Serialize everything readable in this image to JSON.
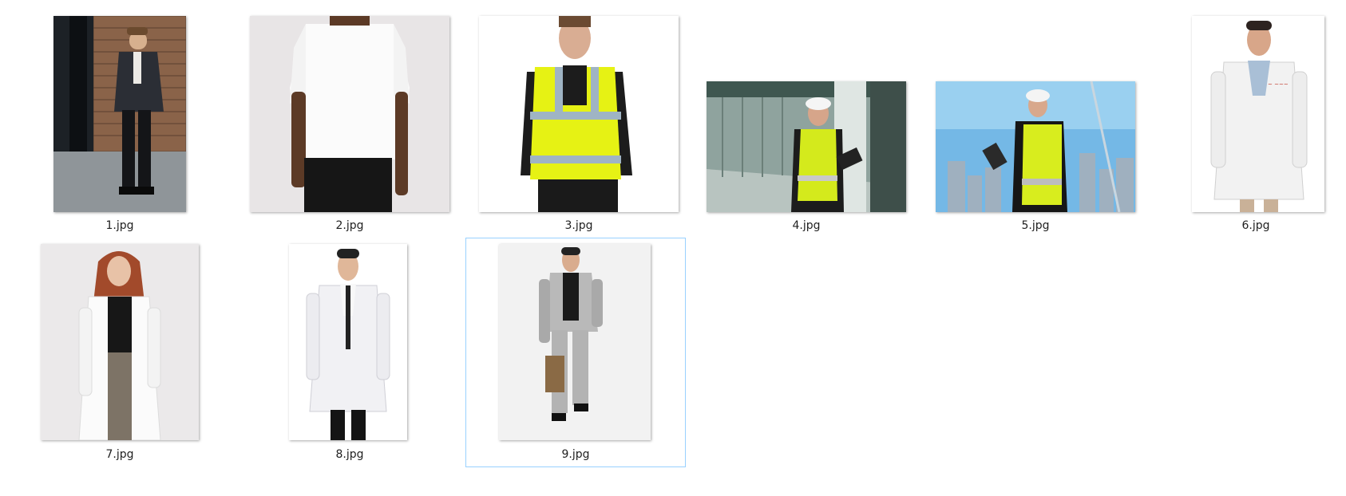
{
  "view": "large-icons",
  "selected_file": "9.jpg",
  "colors": {
    "selection_border": "#99d1ff",
    "label_text": "#1f1f1f"
  },
  "files": [
    {
      "name": "1.jpg",
      "depicts": "man in dark suit and sunglasses by brick wall"
    },
    {
      "name": "2.jpg",
      "depicts": "man in white t-shirt"
    },
    {
      "name": "3.jpg",
      "depicts": "man in yellow high-visibility vest"
    },
    {
      "name": "4.jpg",
      "depicts": "worker in hard hat and safety vest holding tablet in office"
    },
    {
      "name": "5.jpg",
      "depicts": "worker in hard hat and safety vest outdoors against sky"
    },
    {
      "name": "6.jpg",
      "depicts": "man in white lab coat"
    },
    {
      "name": "7.jpg",
      "depicts": "woman in white lab coat"
    },
    {
      "name": "8.jpg",
      "depicts": "man in white lab coat with black tie"
    },
    {
      "name": "9.jpg",
      "depicts": "man in grey checked suit carrying bag"
    }
  ]
}
